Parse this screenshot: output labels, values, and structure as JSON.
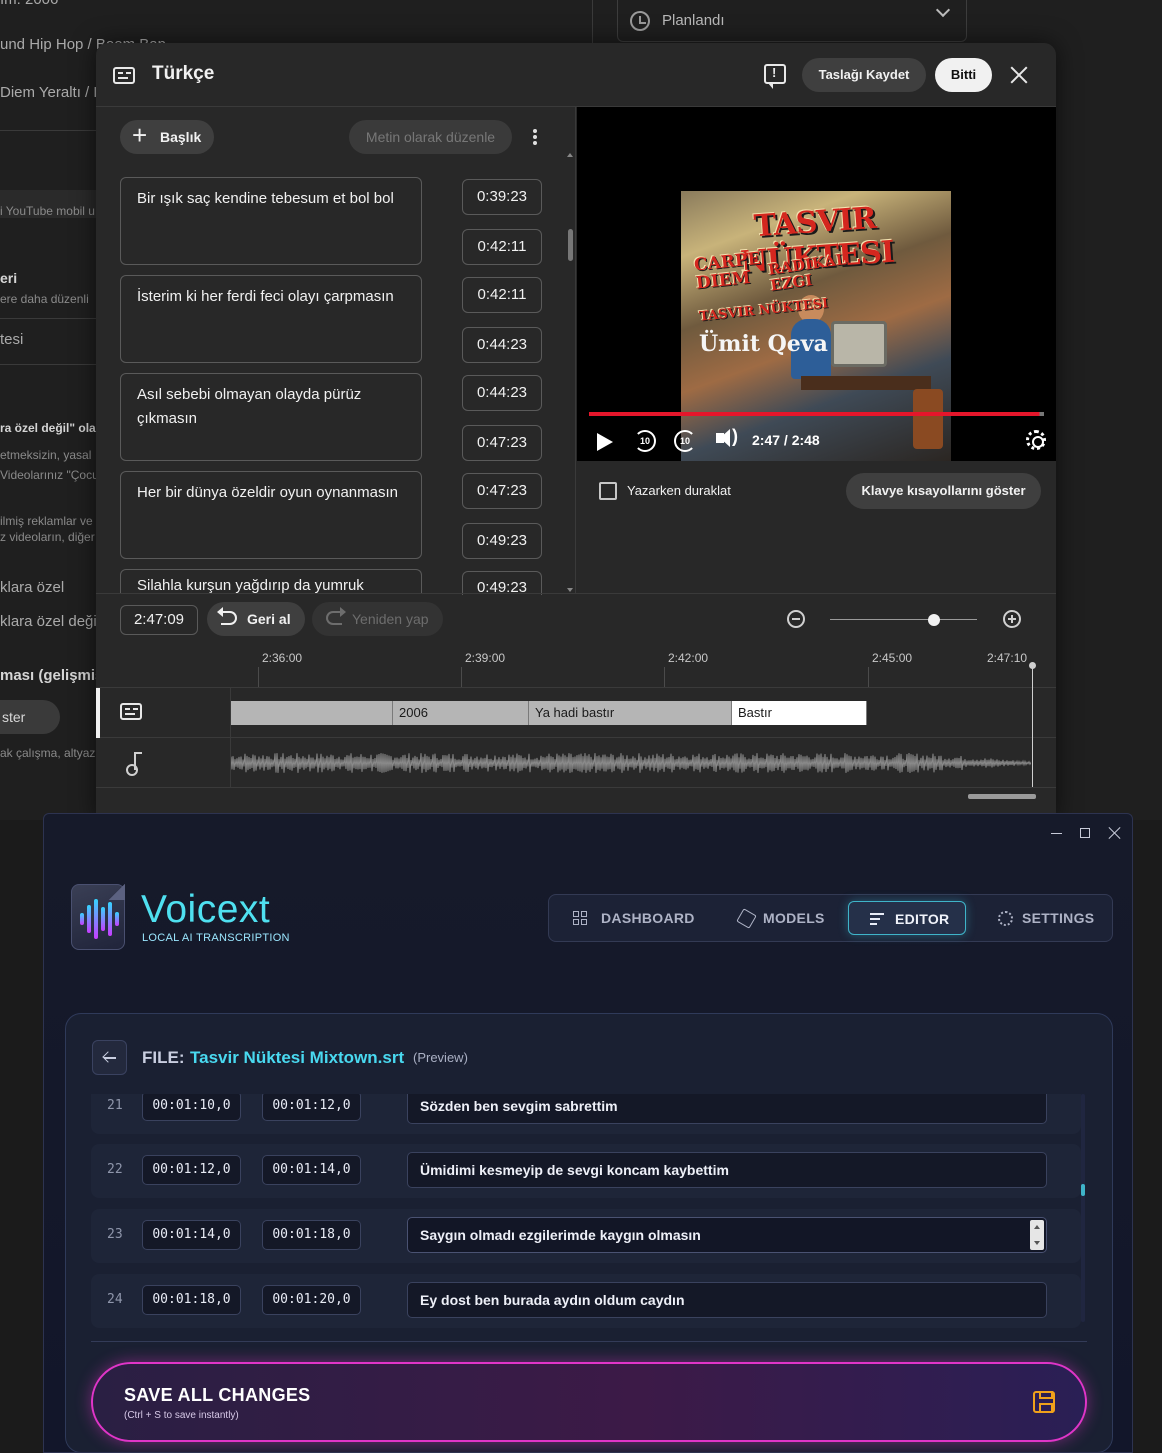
{
  "background": {
    "lines": [
      "ım: 2006",
      "und Hip Hop / Boom Bap",
      "Diem Yeraltı / R",
      "i YouTube mobil u",
      "eri",
      "ere daha düzenli",
      "tesi",
      "ra özel değil\" olar",
      "etmeksizin, yasal",
      "Videolarınız \"Çocu",
      "ilmiş reklamlar ve",
      "z videoların, diğer",
      "klara özel",
      "klara özel değil",
      "ması (gelişmiş",
      "ak çalışma, altyaz"
    ],
    "pill_label": "ster",
    "schedule_value": "Planlandı"
  },
  "modal": {
    "title": "Türkçe",
    "save_draft": "Taslağı Kaydet",
    "done": "Bitti",
    "add_title": "Başlık",
    "edit_as_text": "Metin olarak düzenle",
    "cues": [
      {
        "text": "Bir ışık saç kendine tebesum et bol bol",
        "start": "0:39:23",
        "end": "0:42:11"
      },
      {
        "text": "İsterim ki her ferdi feci olayı çarpmasın",
        "start": "0:42:11",
        "end": "0:44:23"
      },
      {
        "text": "Asıl sebebi olmayan olayda pürüz çıkmasın",
        "start": "0:44:23",
        "end": "0:47:23"
      },
      {
        "text": "Her bir dünya özeldir oyun oynanmasın",
        "start": "0:47:23",
        "end": "0:49:23"
      },
      {
        "text": "Silahla kurşun yağdırıp da yumruk",
        "start": "0:49:23",
        "end": ""
      }
    ],
    "video": {
      "cover_title": "TASVIR NÜKTESI",
      "cover_sub1": "CARPE DIEM",
      "cover_sub2": "RADIKAL EZGI",
      "cover_sub3": "TASVIR NÜKTESI",
      "cover_logo": "Ümit Qeva",
      "skip_back": "10",
      "skip_fwd": "10",
      "time": "2:47 / 2:48",
      "progress": 0.99
    },
    "pause_while_typing": "Yazarken duraklat",
    "show_shortcuts": "Klavye kısayollarını göster",
    "current_time": "2:47:09",
    "undo": "Geri al",
    "redo": "Yeniden yap",
    "zoom_level": 0.71,
    "ruler": [
      "2:36:00",
      "2:39:00",
      "2:42:00",
      "2:45:00",
      "2:47:10"
    ],
    "segments": [
      "",
      "2006",
      "Ya hadi bastır",
      "Bastır"
    ]
  },
  "app": {
    "brand": "Voicext",
    "tagline": "LOCAL AI TRANSCRIPTION",
    "nav": [
      {
        "label": "DASHBOARD",
        "icon": "dashboard-icon"
      },
      {
        "label": "MODELS",
        "icon": "cube-icon"
      },
      {
        "label": "EDITOR",
        "icon": "editor-icon"
      },
      {
        "label": "SETTINGS",
        "icon": "gear-icon"
      }
    ],
    "active_nav": "EDITOR",
    "file_label": "FILE:",
    "file_name": "Tasvir Nüktesi Mixtown.srt",
    "file_mode": "(Preview)",
    "rows": [
      {
        "num": "21",
        "start": "00:01:10,0",
        "end": "00:01:12,0",
        "text": "Sözden ben sevgim sabrettim"
      },
      {
        "num": "22",
        "start": "00:01:12,0",
        "end": "00:01:14,0",
        "text": "Ümidimi kesmeyip de sevgi koncam kaybettim"
      },
      {
        "num": "23",
        "start": "00:01:14,0",
        "end": "00:01:18,0",
        "text": "Saygın olmadı ezgilerimde kaygın olmasın"
      },
      {
        "num": "24",
        "start": "00:01:18,0",
        "end": "00:01:20,0",
        "text": "Ey dost ben burada aydın oldum caydın"
      }
    ],
    "save_title": "SAVE ALL CHANGES",
    "save_hint": "(Ctrl + S to save instantly)",
    "colors": {
      "accent": "#49d9f0",
      "save_border": "#e035c8",
      "save_icon": "#f0a11b"
    }
  }
}
